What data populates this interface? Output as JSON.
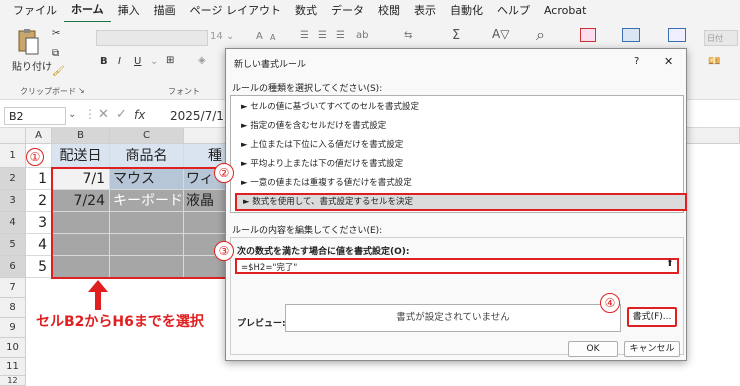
{
  "ribbon": {
    "tabs": [
      "ファイル",
      "ホーム",
      "挿入",
      "描画",
      "ページ レイアウト",
      "数式",
      "データ",
      "校閲",
      "表示",
      "自動化",
      "ヘルプ",
      "Acrobat"
    ],
    "active_tab": "ホーム",
    "paste_label": "貼り付け",
    "clipboard_label": "クリップボード",
    "font_label": "フォント",
    "font_size": "14",
    "font_big": "A",
    "font_small": "A",
    "sigma": "Σ",
    "bold": "B",
    "italic": "I",
    "underline": "U",
    "right_label": "日付"
  },
  "formula_bar": {
    "name_box": "B2",
    "fx": "fx",
    "value": "2025/7/1"
  },
  "sheet": {
    "columns": [
      "A",
      "B",
      "C"
    ],
    "rows": [
      "1",
      "2",
      "3",
      "4",
      "5",
      "6",
      "7",
      "8",
      "9",
      "10",
      "11",
      "12"
    ],
    "headers": [
      "配送日",
      "商品名",
      "種"
    ],
    "row2": {
      "num": "1",
      "date": "7/1",
      "item": "マウス",
      "cat": "ワィ"
    },
    "row3": {
      "num": "2",
      "date": "7/24",
      "item": "キーボード",
      "cat": "液晶"
    },
    "row4": {
      "num": "3"
    },
    "row5": {
      "num": "4"
    },
    "row6": {
      "num": "5"
    },
    "annotation": "セルB2からH6までを選択"
  },
  "callouts": [
    "①",
    "②",
    "③",
    "④"
  ],
  "dialog": {
    "title": "新しい書式ルール",
    "help": "?",
    "close": "✕",
    "select_type_label": "ルールの種類を選択してください(S):",
    "rule_types": [
      "► セルの値に基づいてすべてのセルを書式設定",
      "► 指定の値を含むセルだけを書式設定",
      "► 上位または下位に入る値だけを書式設定",
      "► 平均より上または下の値だけを書式設定",
      "► 一意の値または重複する値だけを書式設定",
      "► 数式を使用して、書式設定するセルを決定"
    ],
    "edit_label": "ルールの内容を編集してください(E):",
    "formula_label": "次の数式を満たす場合に値を書式設定(O):",
    "formula_value": "=$H2=\"完了\"",
    "preview_label": "プレビュー:",
    "preview_text": "書式が設定されていません",
    "format_button": "書式(F)...",
    "ok": "OK",
    "cancel": "キャンセル"
  },
  "colors": {
    "accent": "#e02020",
    "selection": "#a6a6a6",
    "header_fill": "#d9e4f0",
    "excel_green": "#217346"
  }
}
